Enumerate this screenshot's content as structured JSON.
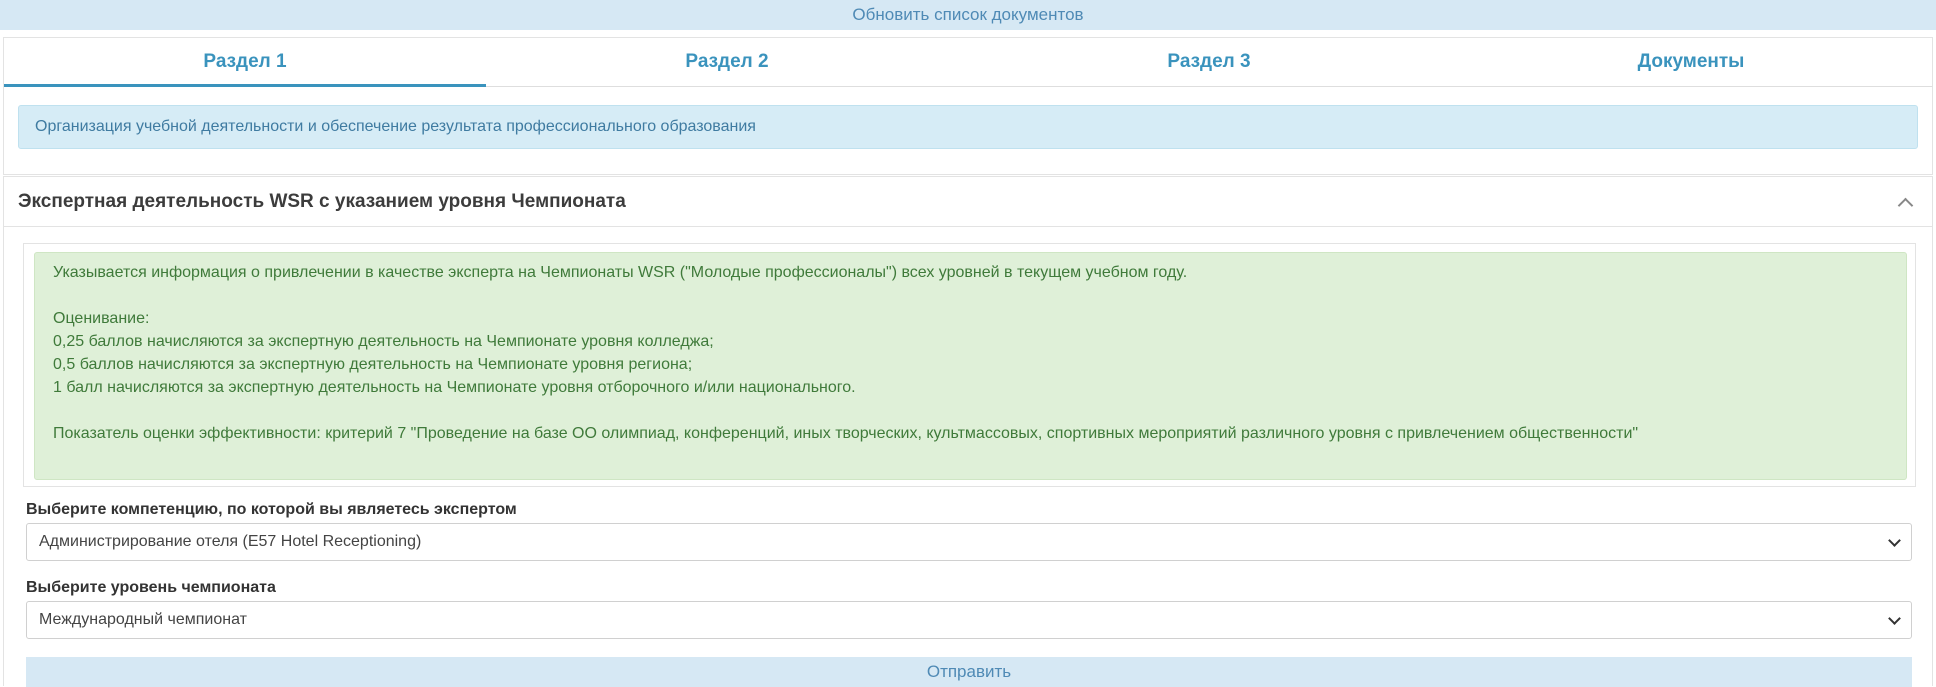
{
  "top_button": {
    "label": "Обновить список документов"
  },
  "tabs": [
    {
      "label": "Раздел 1",
      "active": true
    },
    {
      "label": "Раздел 2",
      "active": false
    },
    {
      "label": "Раздел 3",
      "active": false
    },
    {
      "label": "Документы",
      "active": false
    }
  ],
  "section": {
    "info": "Организация учебной деятельности и обеспечение результата профессионального образования"
  },
  "card": {
    "title": "Экспертная деятельность WSR с указанием уровня Чемпионата",
    "collapse_icon": "chevron-up-icon",
    "alert": {
      "line1": "Указывается информация о привлечении в качестве эксперта на Чемпионаты WSR (\"Молодые профессионалы\") всех уровней в текущем учебном году.",
      "line2": "Оценивание:",
      "line3": "0,25 баллов начисляются за экспертную деятельность на Чемпионате уровня колледжа;",
      "line4": "0,5 баллов начисляются за экспертную деятельность на Чемпионате уровня региона;",
      "line5": "1 балл начисляются за экспертную деятельность на Чемпионате уровня отборочного и/или национального.",
      "line6": "Показатель оценки эффективности: критерий 7 \"Проведение на базе ОО олимпиад, конференций, иных творческих, культмассовых, спортивных мероприятий различного уровня с привлечением общественности\""
    },
    "competence": {
      "label": "Выберите компетенцию, по которой вы являетесь экспертом",
      "value": "Администрирование отеля (E57 Hotel Receptioning)"
    },
    "level": {
      "label": "Выберите уровень чемпионата",
      "value": "Международный чемпионат"
    },
    "submit_label": "Отправить"
  },
  "colors": {
    "accent": "#3a93bd",
    "light_button_bg": "#d6e8f4",
    "info_bg": "#d6ecf6",
    "success_bg": "#dff0d8",
    "success_text": "#3f7a3a"
  }
}
